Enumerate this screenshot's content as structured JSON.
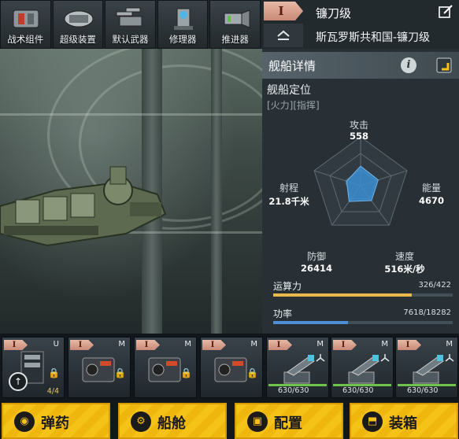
{
  "modules": [
    {
      "label": "战术组件",
      "icon": "tactical-module-icon"
    },
    {
      "label": "超级装置",
      "icon": "super-device-icon"
    },
    {
      "label": "默认武器",
      "icon": "default-weapon-icon"
    },
    {
      "label": "修理器",
      "icon": "repairer-icon"
    },
    {
      "label": "推进器",
      "icon": "thruster-icon"
    }
  ],
  "header": {
    "tier": "I",
    "ship_name": "镰刀级",
    "ship_fullname": "斯瓦罗斯共和国-镰刀级"
  },
  "details": {
    "title": "舰船详情",
    "info_glyph": "i",
    "role_heading": "舰船定位",
    "role_tags": "[火力][指挥]",
    "stats": {
      "attack": {
        "label": "攻击",
        "value": "558",
        "level": 0.4
      },
      "energy": {
        "label": "能量",
        "value": "4670",
        "level": 0.38
      },
      "speed": {
        "label": "速度",
        "value": "516米/秒",
        "level": 0.38
      },
      "defense": {
        "label": "防御",
        "value": "26414",
        "level": 0.4
      },
      "range": {
        "label": "射程",
        "value": "21.8千米",
        "level": 0.3
      }
    },
    "compute": {
      "label": "运算力",
      "value": "326/422",
      "fraction": 0.773,
      "color": "#e9b949"
    },
    "power": {
      "label": "功率",
      "value": "7618/18282",
      "fraction": 0.417,
      "color": "#4f8fd6"
    }
  },
  "equipment": [
    {
      "tier": "I",
      "type": "U",
      "count": "4/4",
      "lock": "🔒",
      "kind": "utility"
    },
    {
      "tier": "I",
      "type": "M",
      "lock": "🔒",
      "kind": "module"
    },
    {
      "tier": "I",
      "type": "M",
      "lock": "🔒",
      "kind": "module"
    },
    {
      "tier": "I",
      "type": "M",
      "lock": "🔒",
      "kind": "module"
    },
    {
      "tier": "I",
      "type": "M",
      "health": "630/630",
      "kind": "turret"
    },
    {
      "tier": "I",
      "type": "M",
      "health": "630/630",
      "kind": "turret"
    },
    {
      "tier": "I",
      "type": "M",
      "health": "630/630",
      "kind": "turret"
    }
  ],
  "bottom_buttons": [
    {
      "label": "弹药",
      "icon": "ammo-icon"
    },
    {
      "label": "船舱",
      "icon": "cabin-icon"
    },
    {
      "label": "配置",
      "icon": "config-icon"
    },
    {
      "label": "装箱",
      "icon": "crate-icon"
    }
  ],
  "colors": {
    "accent_yellow": "#f5c218",
    "panel": "#283035",
    "tier_tag": "#d9a08c"
  }
}
